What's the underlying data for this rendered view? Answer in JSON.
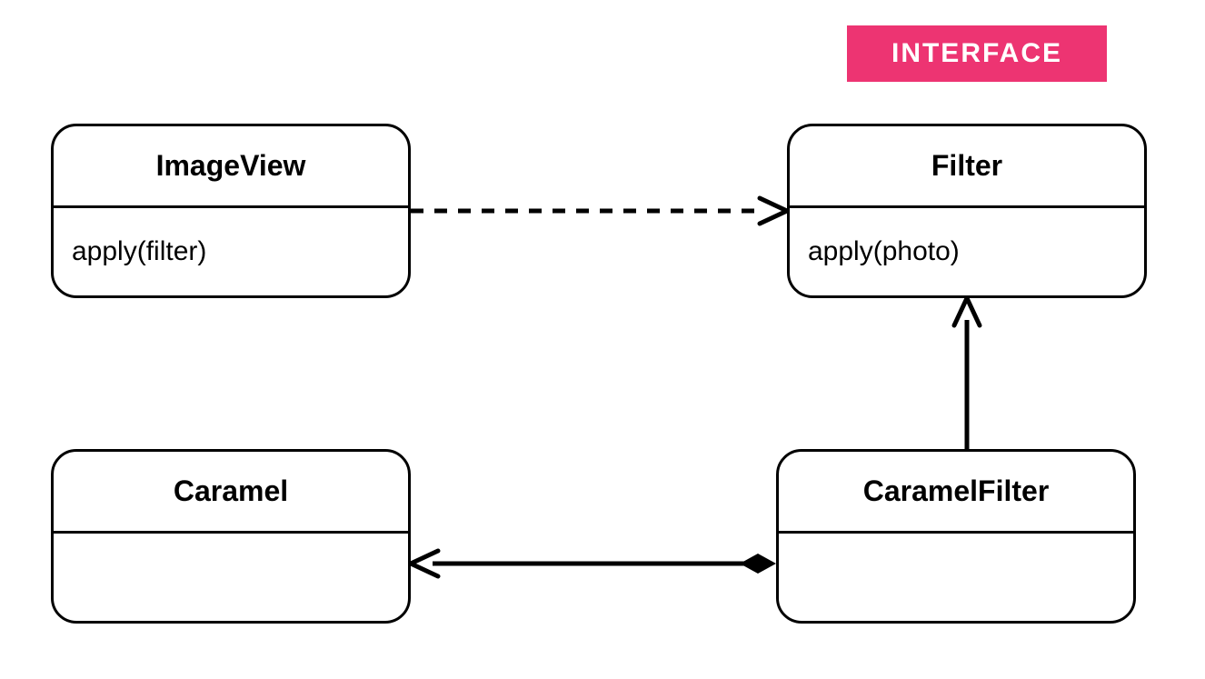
{
  "stereotype": {
    "label": "INTERFACE"
  },
  "colors": {
    "badge": "#ed3472",
    "badgeText": "#ffffff",
    "stroke": "#000000"
  },
  "classes": {
    "imageView": {
      "name": "ImageView",
      "method": "apply(filter)"
    },
    "filter": {
      "name": "Filter",
      "method": "apply(photo)"
    },
    "caramel": {
      "name": "Caramel",
      "method": ""
    },
    "caramelFilter": {
      "name": "CaramelFilter",
      "method": ""
    }
  },
  "relations": {
    "imageView_to_filter": {
      "type": "dependency-dashed-open-arrow"
    },
    "caramelFilter_to_filter": {
      "type": "generalization-solid-open-arrow"
    },
    "caramelFilter_to_caramel": {
      "type": "composition-diamond-open-arrow"
    }
  }
}
